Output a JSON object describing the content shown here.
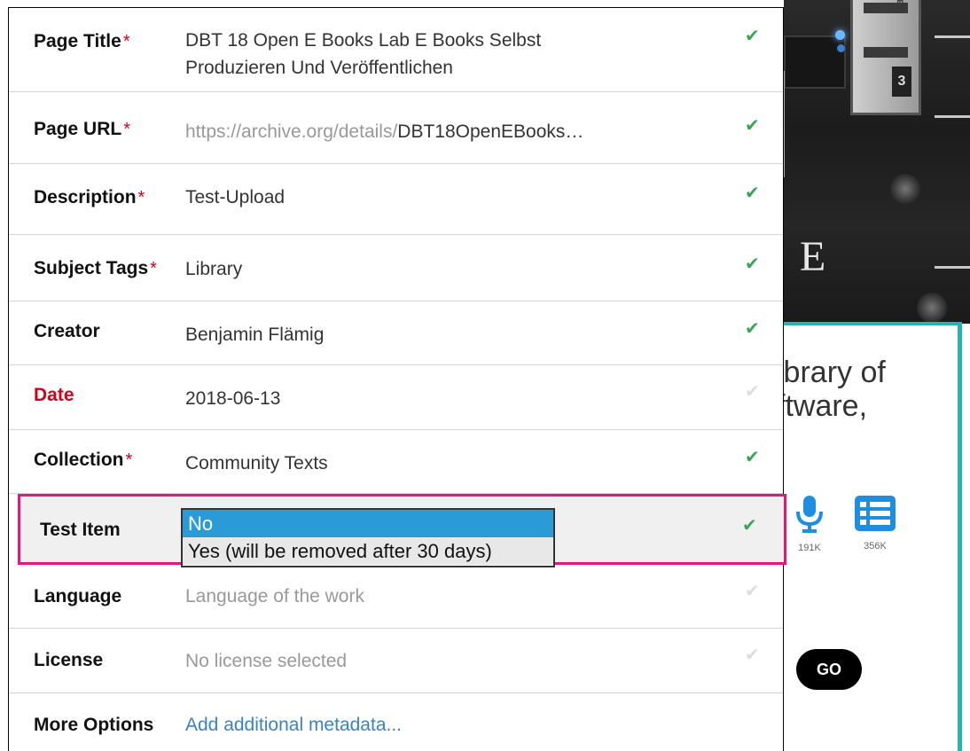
{
  "background": {
    "photo_number": "3",
    "photo_letter": "E",
    "headline_line1": "ibrary of",
    "headline_line2": "ftware,",
    "stats": [
      {
        "icon": "microphone-icon",
        "count": "191K"
      },
      {
        "icon": "list-icon",
        "count": "356K"
      }
    ],
    "go_label": "GO",
    "accent": "#27b3b1"
  },
  "form": {
    "rows": [
      {
        "label": "Page Title",
        "required": true,
        "value_line1": "DBT 18 Open E Books Lab E Books Selbst",
        "value_line2": "Produzieren Und Veröffentlichen",
        "check": "✔"
      },
      {
        "label": "Page URL",
        "required": true,
        "url_prefix": "https://archive.org/details/",
        "url_suffix": "DBT18OpenEBooks…",
        "check": "✔"
      },
      {
        "label": "Description",
        "required": true,
        "value": "Test-Upload",
        "check": "✔"
      },
      {
        "label": "Subject Tags",
        "required": true,
        "value": "Library",
        "check": "✔"
      },
      {
        "label": "Creator",
        "required": false,
        "value": "Benjamin Flämig",
        "check": "✔"
      },
      {
        "label": "Date",
        "required": false,
        "value": "2018-06-13",
        "check": "✔"
      },
      {
        "label": "Collection",
        "required": true,
        "value": "Community Texts",
        "check": "✔"
      },
      {
        "label": "Test Item",
        "required": false,
        "check": "✔"
      },
      {
        "label": "Language",
        "required": false,
        "placeholder": "Language of the work",
        "check": "✔"
      },
      {
        "label": "License",
        "required": false,
        "placeholder": "No license selected",
        "check": "✔"
      },
      {
        "label": "More Options",
        "required": false,
        "link": "Add additional metadata..."
      }
    ],
    "required_mark": "*",
    "test_item_options": [
      "No",
      "Yes (will be removed after 30 days)"
    ],
    "test_item_selected": "No",
    "colors": {
      "check": "#3aa55a",
      "required": "#d0021b",
      "highlight_border": "#e3187d",
      "selected_option": "#2b9bd8",
      "link": "#3b82c4"
    }
  }
}
